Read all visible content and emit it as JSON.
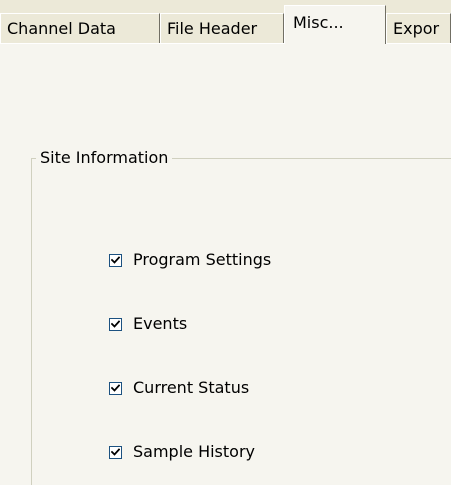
{
  "tabs": [
    {
      "label": "Channel Data",
      "selected": false
    },
    {
      "label": "File Header",
      "selected": false
    },
    {
      "label": "Misc...",
      "selected": true
    },
    {
      "label": "Expor",
      "selected": false
    }
  ],
  "site_information": {
    "title": "Site Information",
    "options": [
      {
        "label": "Program Settings",
        "checked": true
      },
      {
        "label": "Events",
        "checked": true
      },
      {
        "label": "Current Status",
        "checked": true
      },
      {
        "label": "Sample History",
        "checked": true
      }
    ]
  }
}
